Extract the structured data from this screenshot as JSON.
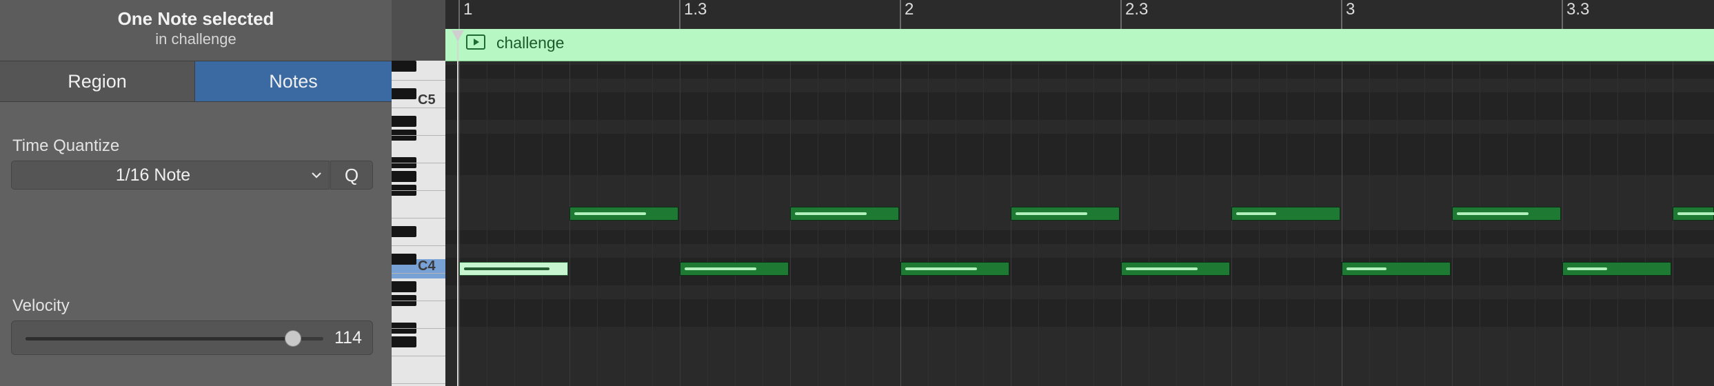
{
  "inspector": {
    "title": "One Note selected",
    "subtitle": "in challenge",
    "tabs": [
      {
        "label": "Region",
        "active": false
      },
      {
        "label": "Notes",
        "active": true
      }
    ],
    "time_quantize": {
      "label": "Time Quantize",
      "value": "1/16 Note",
      "q_label": "Q"
    },
    "velocity": {
      "label": "Velocity",
      "value": "114",
      "max": 127
    }
  },
  "keyboard": {
    "labels": [
      "C5",
      "C4"
    ],
    "highlight": "C4"
  },
  "ruler": {
    "labels": [
      "1",
      "1.3",
      "2",
      "2.3",
      "3",
      "3.3"
    ]
  },
  "region": {
    "name": "challenge",
    "color": "#b6f7c3"
  },
  "notes": [
    {
      "pitch": "C4",
      "bar": 1,
      "beat": 1.0,
      "selected": true,
      "velocity_fraction": 0.9
    },
    {
      "pitch": "E4",
      "bar": 1,
      "beat": 2.0,
      "selected": false,
      "velocity_fraction": 0.75
    },
    {
      "pitch": "C4",
      "bar": 1,
      "beat": 3.0,
      "selected": false,
      "velocity_fraction": 0.75
    },
    {
      "pitch": "E4",
      "bar": 1,
      "beat": 4.0,
      "selected": false,
      "velocity_fraction": 0.75
    },
    {
      "pitch": "C4",
      "bar": 2,
      "beat": 1.0,
      "selected": false,
      "velocity_fraction": 0.75
    },
    {
      "pitch": "E4",
      "bar": 2,
      "beat": 2.0,
      "selected": false,
      "velocity_fraction": 0.75
    },
    {
      "pitch": "C4",
      "bar": 2,
      "beat": 3.0,
      "selected": false,
      "velocity_fraction": 0.75
    },
    {
      "pitch": "E4",
      "bar": 2,
      "beat": 4.0,
      "selected": false,
      "velocity_fraction": 0.42
    },
    {
      "pitch": "C4",
      "bar": 3,
      "beat": 1.0,
      "selected": false,
      "velocity_fraction": 0.42
    },
    {
      "pitch": "E4",
      "bar": 3,
      "beat": 2.0,
      "selected": false,
      "velocity_fraction": 0.75
    },
    {
      "pitch": "C4",
      "bar": 3,
      "beat": 3.0,
      "selected": false,
      "velocity_fraction": 0.42
    },
    {
      "pitch": "E4",
      "bar": 3,
      "beat": 4.0,
      "selected": false,
      "velocity_fraction": 0.42
    }
  ],
  "colors": {
    "accent": "#3b6aa3",
    "note": "#1e7a33",
    "note_selected": "#c6f5cf"
  },
  "icons": [
    "chevron-down-icon",
    "region-play-icon",
    "playhead-icon"
  ]
}
